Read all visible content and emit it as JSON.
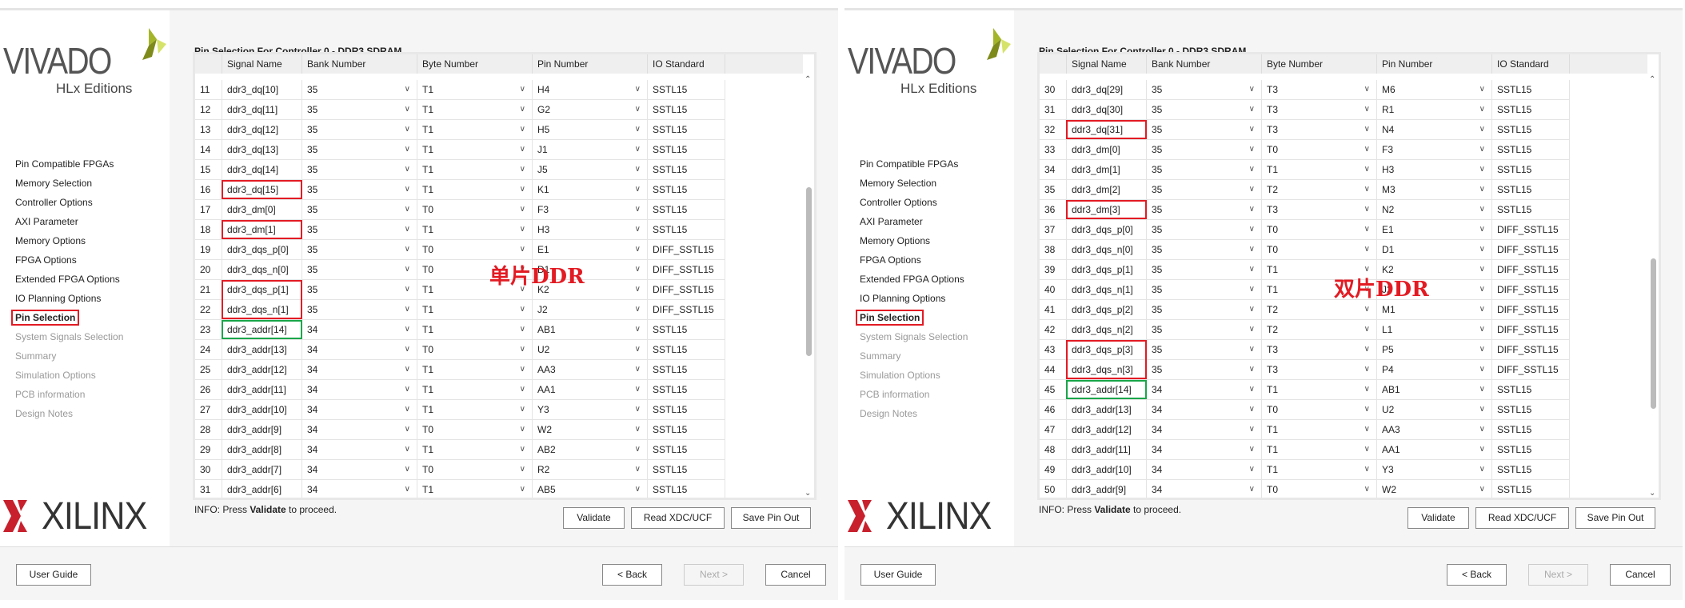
{
  "common": {
    "vivado_logo": "VIVADO",
    "vivado_sub": "HLx Editions",
    "xilinx_logo": "XILINX",
    "page_title": "Pin Selection For Controller 0 - DDR3 SDRAM",
    "columns": [
      "",
      "Signal Name",
      "Bank Number",
      "Byte Number",
      "Pin Number",
      "IO Standard"
    ],
    "nav": [
      {
        "label": "Pin Compatible FPGAs",
        "state": "done"
      },
      {
        "label": "Memory Selection",
        "state": "done"
      },
      {
        "label": "Controller Options",
        "state": "done"
      },
      {
        "label": "AXI Parameter",
        "state": "done"
      },
      {
        "label": "Memory Options",
        "state": "done"
      },
      {
        "label": "FPGA Options",
        "state": "done"
      },
      {
        "label": "Extended FPGA Options",
        "state": "done"
      },
      {
        "label": "IO Planning Options",
        "state": "done"
      },
      {
        "label": "Pin Selection",
        "state": "current"
      },
      {
        "label": "System Signals Selection",
        "state": "disabled"
      },
      {
        "label": "Summary",
        "state": "disabled"
      },
      {
        "label": "Simulation Options",
        "state": "disabled"
      },
      {
        "label": "PCB information",
        "state": "disabled"
      },
      {
        "label": "Design Notes",
        "state": "disabled"
      }
    ],
    "info_prefix": "INFO: Press ",
    "info_bold": "Validate",
    "info_suffix": " to proceed.",
    "buttons": {
      "validate": "Validate",
      "read": "Read XDC/UCF",
      "save": "Save Pin Out",
      "user_guide": "User Guide",
      "back": "< Back",
      "next": "Next >",
      "cancel": "Cancel"
    },
    "colors": {
      "highlight_red": "#e21b23",
      "highlight_green": "#1aa64a",
      "focus_blue": "#3c6dc6"
    }
  },
  "panels": [
    {
      "overlay_label": "单片DDR",
      "scroll_position": 0.45,
      "rows": [
        {
          "n": "11",
          "signal": "ddr3_dq[10]",
          "bank": "35",
          "byte": "T1",
          "pin": "H4",
          "io": "SSTL15"
        },
        {
          "n": "12",
          "signal": "ddr3_dq[11]",
          "bank": "35",
          "byte": "T1",
          "pin": "G2",
          "io": "SSTL15"
        },
        {
          "n": "13",
          "signal": "ddr3_dq[12]",
          "bank": "35",
          "byte": "T1",
          "pin": "H5",
          "io": "SSTL15"
        },
        {
          "n": "14",
          "signal": "ddr3_dq[13]",
          "bank": "35",
          "byte": "T1",
          "pin": "J1",
          "io": "SSTL15"
        },
        {
          "n": "15",
          "signal": "ddr3_dq[14]",
          "bank": "35",
          "byte": "T1",
          "pin": "J5",
          "io": "SSTL15"
        },
        {
          "n": "16",
          "signal": "ddr3_dq[15]",
          "bank": "35",
          "byte": "T1",
          "pin": "K1",
          "io": "SSTL15",
          "box": "red"
        },
        {
          "n": "17",
          "signal": "ddr3_dm[0]",
          "bank": "35",
          "byte": "T0",
          "pin": "F3",
          "io": "SSTL15"
        },
        {
          "n": "18",
          "signal": "ddr3_dm[1]",
          "bank": "35",
          "byte": "T1",
          "pin": "H3",
          "io": "SSTL15",
          "box": "red"
        },
        {
          "n": "19",
          "signal": "ddr3_dqs_p[0]",
          "bank": "35",
          "byte": "T0",
          "pin": "E1",
          "io": "DIFF_SSTL15"
        },
        {
          "n": "20",
          "signal": "ddr3_dqs_n[0]",
          "bank": "35",
          "byte": "T0",
          "pin": "D1",
          "io": "DIFF_SSTL15"
        },
        {
          "n": "21",
          "signal": "ddr3_dqs_p[1]",
          "bank": "35",
          "byte": "T1",
          "pin": "K2",
          "io": "DIFF_SSTL15",
          "box": "red",
          "group": "start"
        },
        {
          "n": "22",
          "signal": "ddr3_dqs_n[1]",
          "bank": "35",
          "byte": "T1",
          "pin": "J2",
          "io": "DIFF_SSTL15",
          "box": "red",
          "group": "end"
        },
        {
          "n": "23",
          "signal": "ddr3_addr[14]",
          "bank": "34",
          "byte": "T1",
          "pin": "AB1",
          "io": "SSTL15",
          "box": "green"
        },
        {
          "n": "24",
          "signal": "ddr3_addr[13]",
          "bank": "34",
          "byte": "T0",
          "pin": "U2",
          "io": "SSTL15"
        },
        {
          "n": "25",
          "signal": "ddr3_addr[12]",
          "bank": "34",
          "byte": "T1",
          "pin": "AA3",
          "io": "SSTL15"
        },
        {
          "n": "26",
          "signal": "ddr3_addr[11]",
          "bank": "34",
          "byte": "T1",
          "pin": "AA1",
          "io": "SSTL15"
        },
        {
          "n": "27",
          "signal": "ddr3_addr[10]",
          "bank": "34",
          "byte": "T1",
          "pin": "Y3",
          "io": "SSTL15"
        },
        {
          "n": "28",
          "signal": "ddr3_addr[9]",
          "bank": "34",
          "byte": "T0",
          "pin": "W2",
          "io": "SSTL15"
        },
        {
          "n": "29",
          "signal": "ddr3_addr[8]",
          "bank": "34",
          "byte": "T1",
          "pin": "AB2",
          "io": "SSTL15"
        },
        {
          "n": "30",
          "signal": "ddr3_addr[7]",
          "bank": "34",
          "byte": "T0",
          "pin": "R2",
          "io": "SSTL15"
        },
        {
          "n": "31",
          "signal": "ddr3_addr[6]",
          "bank": "34",
          "byte": "T1",
          "pin": "AB5",
          "io": "SSTL15"
        }
      ]
    },
    {
      "overlay_label": "双片DDR",
      "scroll_position": 0.6,
      "rows": [
        {
          "n": "30",
          "signal": "ddr3_dq[29]",
          "bank": "35",
          "byte": "T3",
          "pin": "M6",
          "io": "SSTL15"
        },
        {
          "n": "31",
          "signal": "ddr3_dq[30]",
          "bank": "35",
          "byte": "T3",
          "pin": "R1",
          "io": "SSTL15"
        },
        {
          "n": "32",
          "signal": "ddr3_dq[31]",
          "bank": "35",
          "byte": "T3",
          "pin": "N4",
          "io": "SSTL15",
          "box": "red"
        },
        {
          "n": "33",
          "signal": "ddr3_dm[0]",
          "bank": "35",
          "byte": "T0",
          "pin": "F3",
          "io": "SSTL15"
        },
        {
          "n": "34",
          "signal": "ddr3_dm[1]",
          "bank": "35",
          "byte": "T1",
          "pin": "H3",
          "io": "SSTL15"
        },
        {
          "n": "35",
          "signal": "ddr3_dm[2]",
          "bank": "35",
          "byte": "T2",
          "pin": "M3",
          "io": "SSTL15"
        },
        {
          "n": "36",
          "signal": "ddr3_dm[3]",
          "bank": "35",
          "byte": "T3",
          "pin": "N2",
          "io": "SSTL15",
          "box": "red"
        },
        {
          "n": "37",
          "signal": "ddr3_dqs_p[0]",
          "bank": "35",
          "byte": "T0",
          "pin": "E1",
          "io": "DIFF_SSTL15"
        },
        {
          "n": "38",
          "signal": "ddr3_dqs_n[0]",
          "bank": "35",
          "byte": "T0",
          "pin": "D1",
          "io": "DIFF_SSTL15"
        },
        {
          "n": "39",
          "signal": "ddr3_dqs_p[1]",
          "bank": "35",
          "byte": "T1",
          "pin": "K2",
          "io": "DIFF_SSTL15"
        },
        {
          "n": "40",
          "signal": "ddr3_dqs_n[1]",
          "bank": "35",
          "byte": "T1",
          "pin": "J2",
          "io": "DIFF_SSTL15"
        },
        {
          "n": "41",
          "signal": "ddr3_dqs_p[2]",
          "bank": "35",
          "byte": "T2",
          "pin": "M1",
          "io": "DIFF_SSTL15"
        },
        {
          "n": "42",
          "signal": "ddr3_dqs_n[2]",
          "bank": "35",
          "byte": "T2",
          "pin": "L1",
          "io": "DIFF_SSTL15"
        },
        {
          "n": "43",
          "signal": "ddr3_dqs_p[3]",
          "bank": "35",
          "byte": "T3",
          "pin": "P5",
          "io": "DIFF_SSTL15",
          "box": "red",
          "group": "start"
        },
        {
          "n": "44",
          "signal": "ddr3_dqs_n[3]",
          "bank": "35",
          "byte": "T3",
          "pin": "P4",
          "io": "DIFF_SSTL15",
          "box": "red",
          "group": "end"
        },
        {
          "n": "45",
          "signal": "ddr3_addr[14]",
          "bank": "34",
          "byte": "T1",
          "pin": "AB1",
          "io": "SSTL15",
          "box": "green"
        },
        {
          "n": "46",
          "signal": "ddr3_addr[13]",
          "bank": "34",
          "byte": "T0",
          "pin": "U2",
          "io": "SSTL15"
        },
        {
          "n": "47",
          "signal": "ddr3_addr[12]",
          "bank": "34",
          "byte": "T1",
          "pin": "AA3",
          "io": "SSTL15"
        },
        {
          "n": "48",
          "signal": "ddr3_addr[11]",
          "bank": "34",
          "byte": "T1",
          "pin": "AA1",
          "io": "SSTL15"
        },
        {
          "n": "49",
          "signal": "ddr3_addr[10]",
          "bank": "34",
          "byte": "T1",
          "pin": "Y3",
          "io": "SSTL15"
        },
        {
          "n": "50",
          "signal": "ddr3_addr[9]",
          "bank": "34",
          "byte": "T0",
          "pin": "W2",
          "io": "SSTL15"
        }
      ]
    }
  ]
}
